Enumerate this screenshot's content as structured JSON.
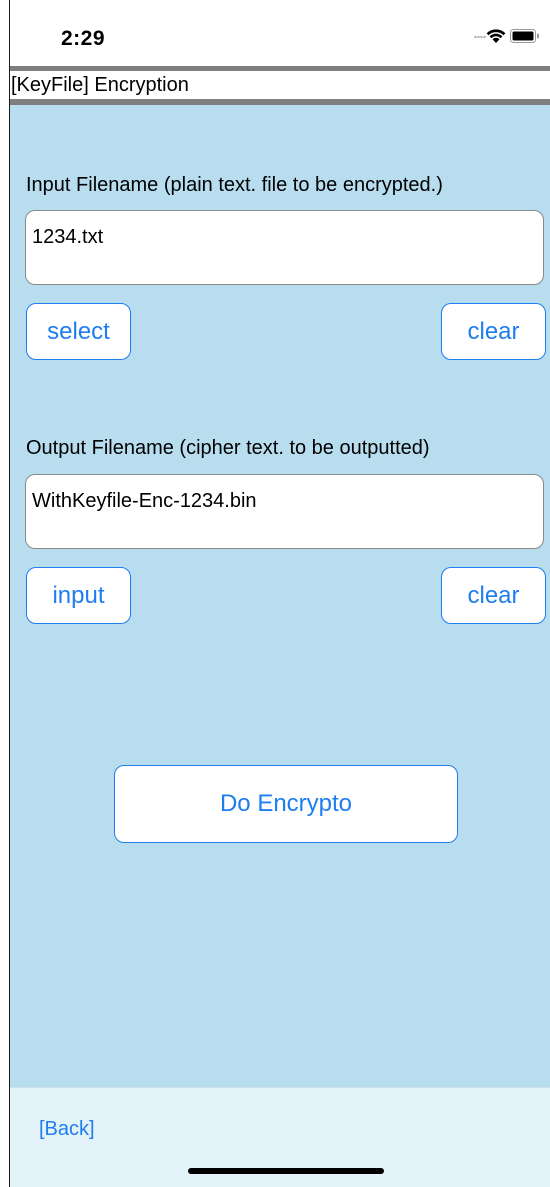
{
  "status_bar": {
    "time": "2:29",
    "icons": [
      "signal-dots-icon",
      "wifi-icon",
      "battery-icon"
    ]
  },
  "header": {
    "title": "[KeyFile] Encryption"
  },
  "input_section": {
    "label": "Input Filename (plain text. file to be encrypted.)",
    "value": "1234.txt",
    "select_label": "select",
    "clear_label": "clear"
  },
  "output_section": {
    "label": "Output Filename (cipher text. to be outputted)",
    "value": "WithKeyfile-Enc-1234.bin",
    "input_label": "input",
    "clear_label": "clear"
  },
  "actions": {
    "do_encrypt_label": "Do Encrypto"
  },
  "footer": {
    "back_label": "[Back]"
  },
  "colors": {
    "content_background": "#b8ddef",
    "footer_background": "#e4f2f9",
    "accent": "#1e7ef0",
    "separator_bar": "#7f7f7f"
  }
}
